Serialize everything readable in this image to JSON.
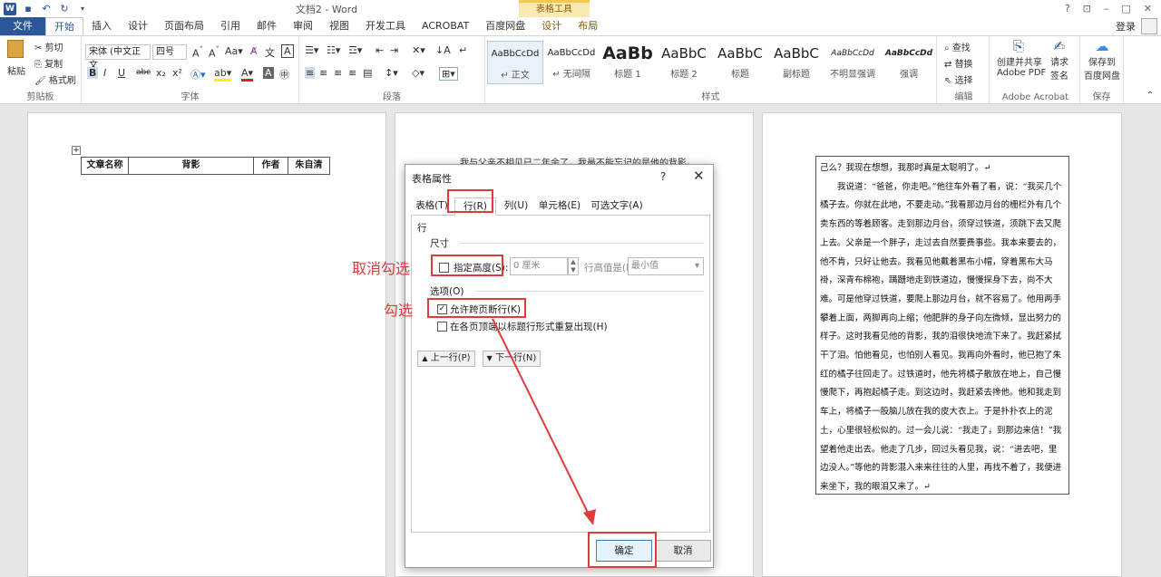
{
  "titlebar": {
    "document_title": "文档2 - Word",
    "context_tab_group": "表格工具",
    "controls": [
      "?",
      "⊡",
      "–",
      "□",
      "✕"
    ]
  },
  "tabs": [
    "文件",
    "开始",
    "插入",
    "设计",
    "页面布局",
    "引用",
    "邮件",
    "审阅",
    "视图",
    "开发工具",
    "ACROBAT",
    "百度网盘",
    "设计",
    "布局"
  ],
  "active_tab": "开始",
  "account": {
    "login": "登录"
  },
  "ribbon": {
    "clipboard": {
      "paste": "粘贴",
      "cut": "剪切",
      "copy": "复制",
      "format_painter": "格式刷",
      "label": "剪贴板"
    },
    "font": {
      "font_name": "宋体 (中文正文",
      "font_size": "四号",
      "label": "字体"
    },
    "paragraph": {
      "label": "段落"
    },
    "styles": {
      "label": "样式",
      "items": [
        {
          "preview": "AaBbCcDd",
          "name": "↵ 正文"
        },
        {
          "preview": "AaBbCcDd",
          "name": "↵ 无间隔"
        },
        {
          "preview": "AaBb",
          "name": "标题 1"
        },
        {
          "preview": "AaBbC",
          "name": "标题 2"
        },
        {
          "preview": "AaBbC",
          "name": "标题"
        },
        {
          "preview": "AaBbC",
          "name": "副标题"
        },
        {
          "preview": "AaBbCcDd",
          "name": "不明显强调"
        },
        {
          "preview": "AaBbCcDd",
          "name": "强调"
        }
      ]
    },
    "editing": {
      "find": "查找",
      "replace": "替换",
      "select": "选择",
      "label": "编辑"
    },
    "acrobat": {
      "create_share": "创建并共享",
      "create_share2": "Adobe PDF",
      "request_sign": "请求",
      "request_sign2": "签名",
      "label": "Adobe Acrobat"
    },
    "save": {
      "baidu": "保存到",
      "baidu2": "百度网盘",
      "label": "保存"
    }
  },
  "left_page": {
    "table_headers": [
      "文章名称",
      "背影",
      "作者",
      "朱自清"
    ]
  },
  "middle_page": {
    "peek_text": "我与父亲不相见已二年余了，我最不能忘记的是他的背影。"
  },
  "right_page": {
    "paragraphs": [
      "己么？我现在想想，我那时真是太聪明了。↵",
      "　　我说道：“爸爸，你走吧。”他往车外看了看，说：“我买几个橘子去。你就在此地，不要走动。”我看那边月台的栅栏外有几个卖东西的等着顾客。走到那边月台，须穿过铁道，须跳下去又爬上去。父亲是一个胖子，走过去自然要费事些。我本来要去的，他不肯，只好让他去。我看见他戴着黑布小帽，穿着黑布大马褂，深青布棉袍，蹒跚地走到铁道边，慢慢探身下去，尚不大难。可是他穿过铁道，要爬上那边月台，就不容易了。他用两手攀着上面，两脚再向上缩；他肥胖的身子向左微倾，显出努力的样子。这时我看见他的背影，我的泪很快地流下来了。我赶紧拭干了泪。怕他看见，也怕别人看见。我再向外看时，他已抱了朱红的橘子往回走了。过铁道时，他先将橘子散放在地上，自己慢慢爬下，再抱起橘子走。到这边时，我赶紧去搀他。他和我走到车上，将橘子一股脑儿放在我的皮大衣上。于是扑扑衣上的泥土，心里很轻松似的。过一会儿说：“我走了，到那边来信！”我望着他走出去。他走了几步，回过头看见我，说：“进去吧，里边没人。”等他的背影混入来来往往的人里，再找不着了，我便进来坐下，我的眼泪又来了。↵"
    ]
  },
  "dialog": {
    "title": "表格属性",
    "help": "?",
    "close": "✕",
    "tabs": [
      "表格(T)",
      "行(R)",
      "列(U)",
      "单元格(E)",
      "可选文字(A)"
    ],
    "active_tab": "行(R)",
    "section_row": "行",
    "section_size": "尺寸",
    "specify_height": {
      "label": "指定高度(S):",
      "checked": false,
      "value": "0 厘米"
    },
    "row_height_is": {
      "label": "行高值是(I):",
      "value": "最小值"
    },
    "section_options": "选项(O)",
    "allow_break": {
      "label": "允许跨页断行(K)",
      "checked": true
    },
    "repeat_header": {
      "label": "在各页顶端以标题行形式重复出现(H)",
      "checked": false
    },
    "prev_row": "上一行(P)",
    "next_row": "下一行(N)",
    "ok": "确定",
    "cancel": "取消"
  },
  "annotations": {
    "uncheck": "取消勾选",
    "check": "勾选",
    "color": "#e03c3c"
  }
}
